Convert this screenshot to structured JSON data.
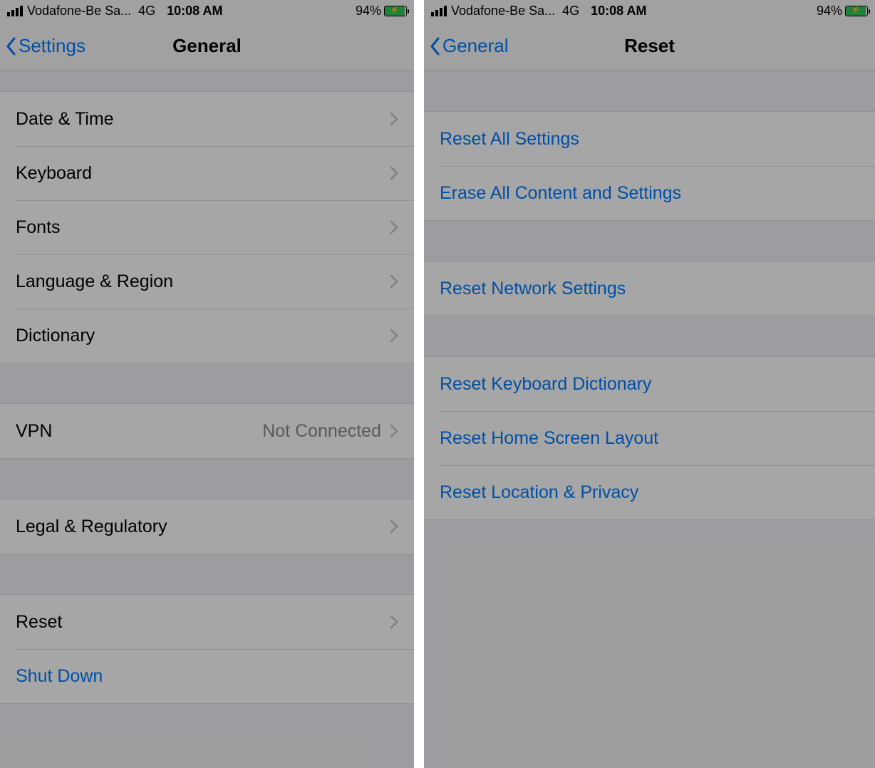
{
  "statusBar": {
    "carrier": "Vodafone-Be Sa...",
    "network": "4G",
    "time": "10:08 AM",
    "batteryPct": "94%"
  },
  "left": {
    "nav": {
      "back": "Settings",
      "title": "General"
    },
    "group1": [
      {
        "label": "Date & Time"
      },
      {
        "label": "Keyboard"
      },
      {
        "label": "Fonts"
      },
      {
        "label": "Language & Region"
      },
      {
        "label": "Dictionary"
      }
    ],
    "group2": [
      {
        "label": "VPN",
        "value": "Not Connected"
      }
    ],
    "group3": [
      {
        "label": "Legal & Regulatory"
      }
    ],
    "group4": [
      {
        "label": "Reset",
        "highlight": true
      },
      {
        "label": "Shut Down",
        "link": true
      }
    ]
  },
  "right": {
    "nav": {
      "back": "General",
      "title": "Reset"
    },
    "group1": [
      {
        "label": "Reset All Settings"
      },
      {
        "label": "Erase All Content and Settings",
        "highlight": true
      }
    ],
    "group2": [
      {
        "label": "Reset Network Settings"
      }
    ],
    "group3": [
      {
        "label": "Reset Keyboard Dictionary"
      },
      {
        "label": "Reset Home Screen Layout"
      },
      {
        "label": "Reset Location & Privacy"
      }
    ]
  }
}
